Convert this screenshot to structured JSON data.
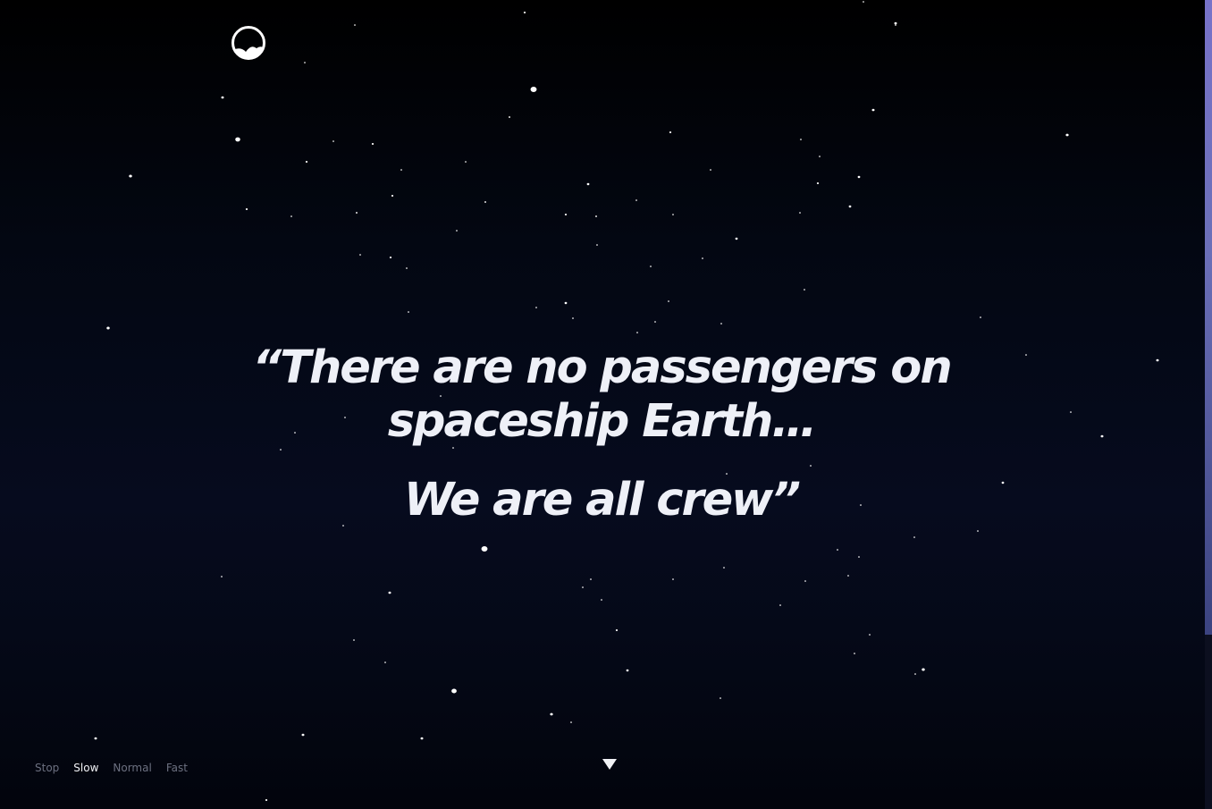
{
  "logo": {
    "icon": "mountain-moon-logo-icon"
  },
  "quote": {
    "line1": "“There are no passengers on spaceship Earth…",
    "line2": "We are all crew”"
  },
  "speed": {
    "options": [
      "Stop",
      "Slow",
      "Normal",
      "Fast"
    ],
    "selected": "Slow"
  },
  "scroll_down": {
    "icon": "triangle-down-icon"
  },
  "colors": {
    "text": "#eef0f7",
    "inactive_control": "#6c7080",
    "active_control": "#f1f2f6",
    "scrollbar_thumb": "#7873c9"
  }
}
